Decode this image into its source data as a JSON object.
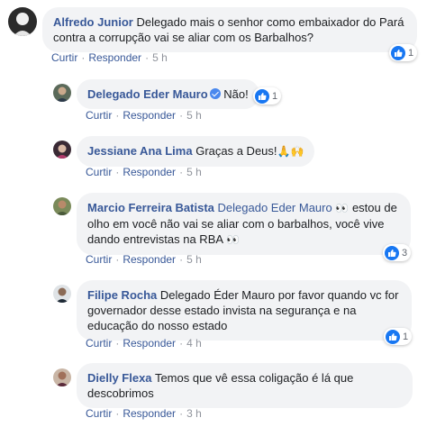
{
  "actions": {
    "like": "Curtir",
    "reply": "Responder",
    "sep": "·"
  },
  "comments": [
    {
      "author": "Alfredo Junior",
      "text": "Delegado mais o senhor como embaixador do Pará contra a corrupção vai se aliar com os Barbalhos?",
      "time": "5 h",
      "reactions": "1"
    },
    {
      "author": "Delegado Eder Mauro",
      "text": "Não!",
      "time": "5 h",
      "reactions": "1"
    },
    {
      "author": "Jessiane Ana Lima",
      "text": "Graças a Deus!",
      "emoji": "🙏🙌",
      "time": "5 h"
    },
    {
      "author": "Marcio Ferreira Batista",
      "mention": "Delegado Eder Mauro",
      "text": "estou de olho em você não vai se aliar com o barbalhos, você vive dando entrevistas na RBA",
      "emoji1": "👀",
      "emoji2": "👀",
      "time": "5 h",
      "reactions": "3"
    },
    {
      "author": "Filipe Rocha",
      "text": "Delegado Éder Mauro por favor quando vc for governador desse estado invista na segurança e na educação do nosso estado",
      "time": "4 h",
      "reactions": "1"
    },
    {
      "author": "Dielly Flexa",
      "text": "Temos que vê essa coligação é lá que descobrimos",
      "time": "3 h"
    }
  ]
}
